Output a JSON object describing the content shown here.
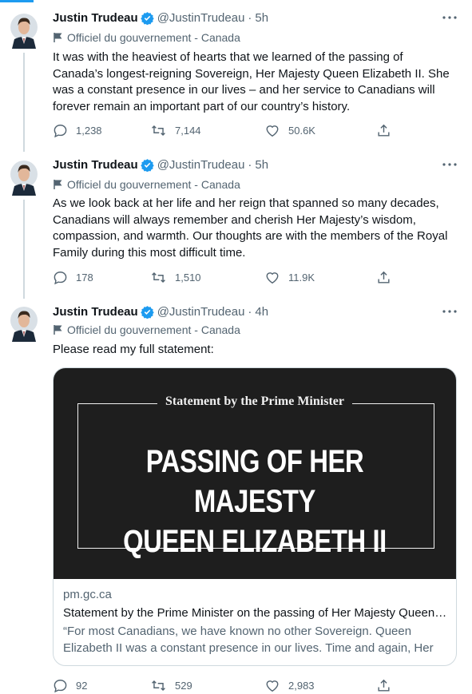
{
  "tweets": [
    {
      "author": "Justin Trudeau",
      "handle": "@JustinTrudeau",
      "separator": "·",
      "time": "5h",
      "label": "Officiel du gouvernement - Canada",
      "text": "It was with the heaviest of hearts that we learned of the passing of Canada’s longest-reigning Sovereign, Her Majesty Queen Elizabeth II. She was a constant presence in our lives – and her service to Canadians will forever remain an important part of our country’s history.",
      "replies": "1,238",
      "retweets": "7,144",
      "likes": "50.6K"
    },
    {
      "author": "Justin Trudeau",
      "handle": "@JustinTrudeau",
      "separator": "·",
      "time": "5h",
      "label": "Officiel du gouvernement - Canada",
      "text": "As we look back at her life and her reign that spanned so many decades, Canadians will always remember and cherish Her Majesty’s wisdom, compassion, and warmth. Our thoughts are with the members of the Royal Family during this most difficult time.",
      "replies": "178",
      "retweets": "1,510",
      "likes": "11.9K"
    },
    {
      "author": "Justin Trudeau",
      "handle": "@JustinTrudeau",
      "separator": "·",
      "time": "4h",
      "label": "Officiel du gouvernement - Canada",
      "text": "Please read my full statement:",
      "replies": "92",
      "retweets": "529",
      "likes": "2,983"
    }
  ],
  "card": {
    "heading": "Statement by the Prime Minister",
    "title_line1": "PASSING OF HER MAJESTY",
    "title_line2": "QUEEN ELIZABETH II",
    "domain": "pm.gc.ca",
    "title": "Statement by the Prime Minister on the passing of Her Majesty Queen…",
    "description": "“For most Canadians, we have known no other Sovereign. Queen Elizabeth II was a constant presence in our lives. Time and again, Her …"
  },
  "colors": {
    "accent": "#1d9bf0",
    "muted_text": "#536471",
    "card_bg": "#1e1e1e"
  },
  "icons": [
    "verified-badge-icon",
    "government-flag-icon",
    "more-options-icon",
    "reply-icon",
    "retweet-icon",
    "like-icon",
    "share-icon"
  ]
}
